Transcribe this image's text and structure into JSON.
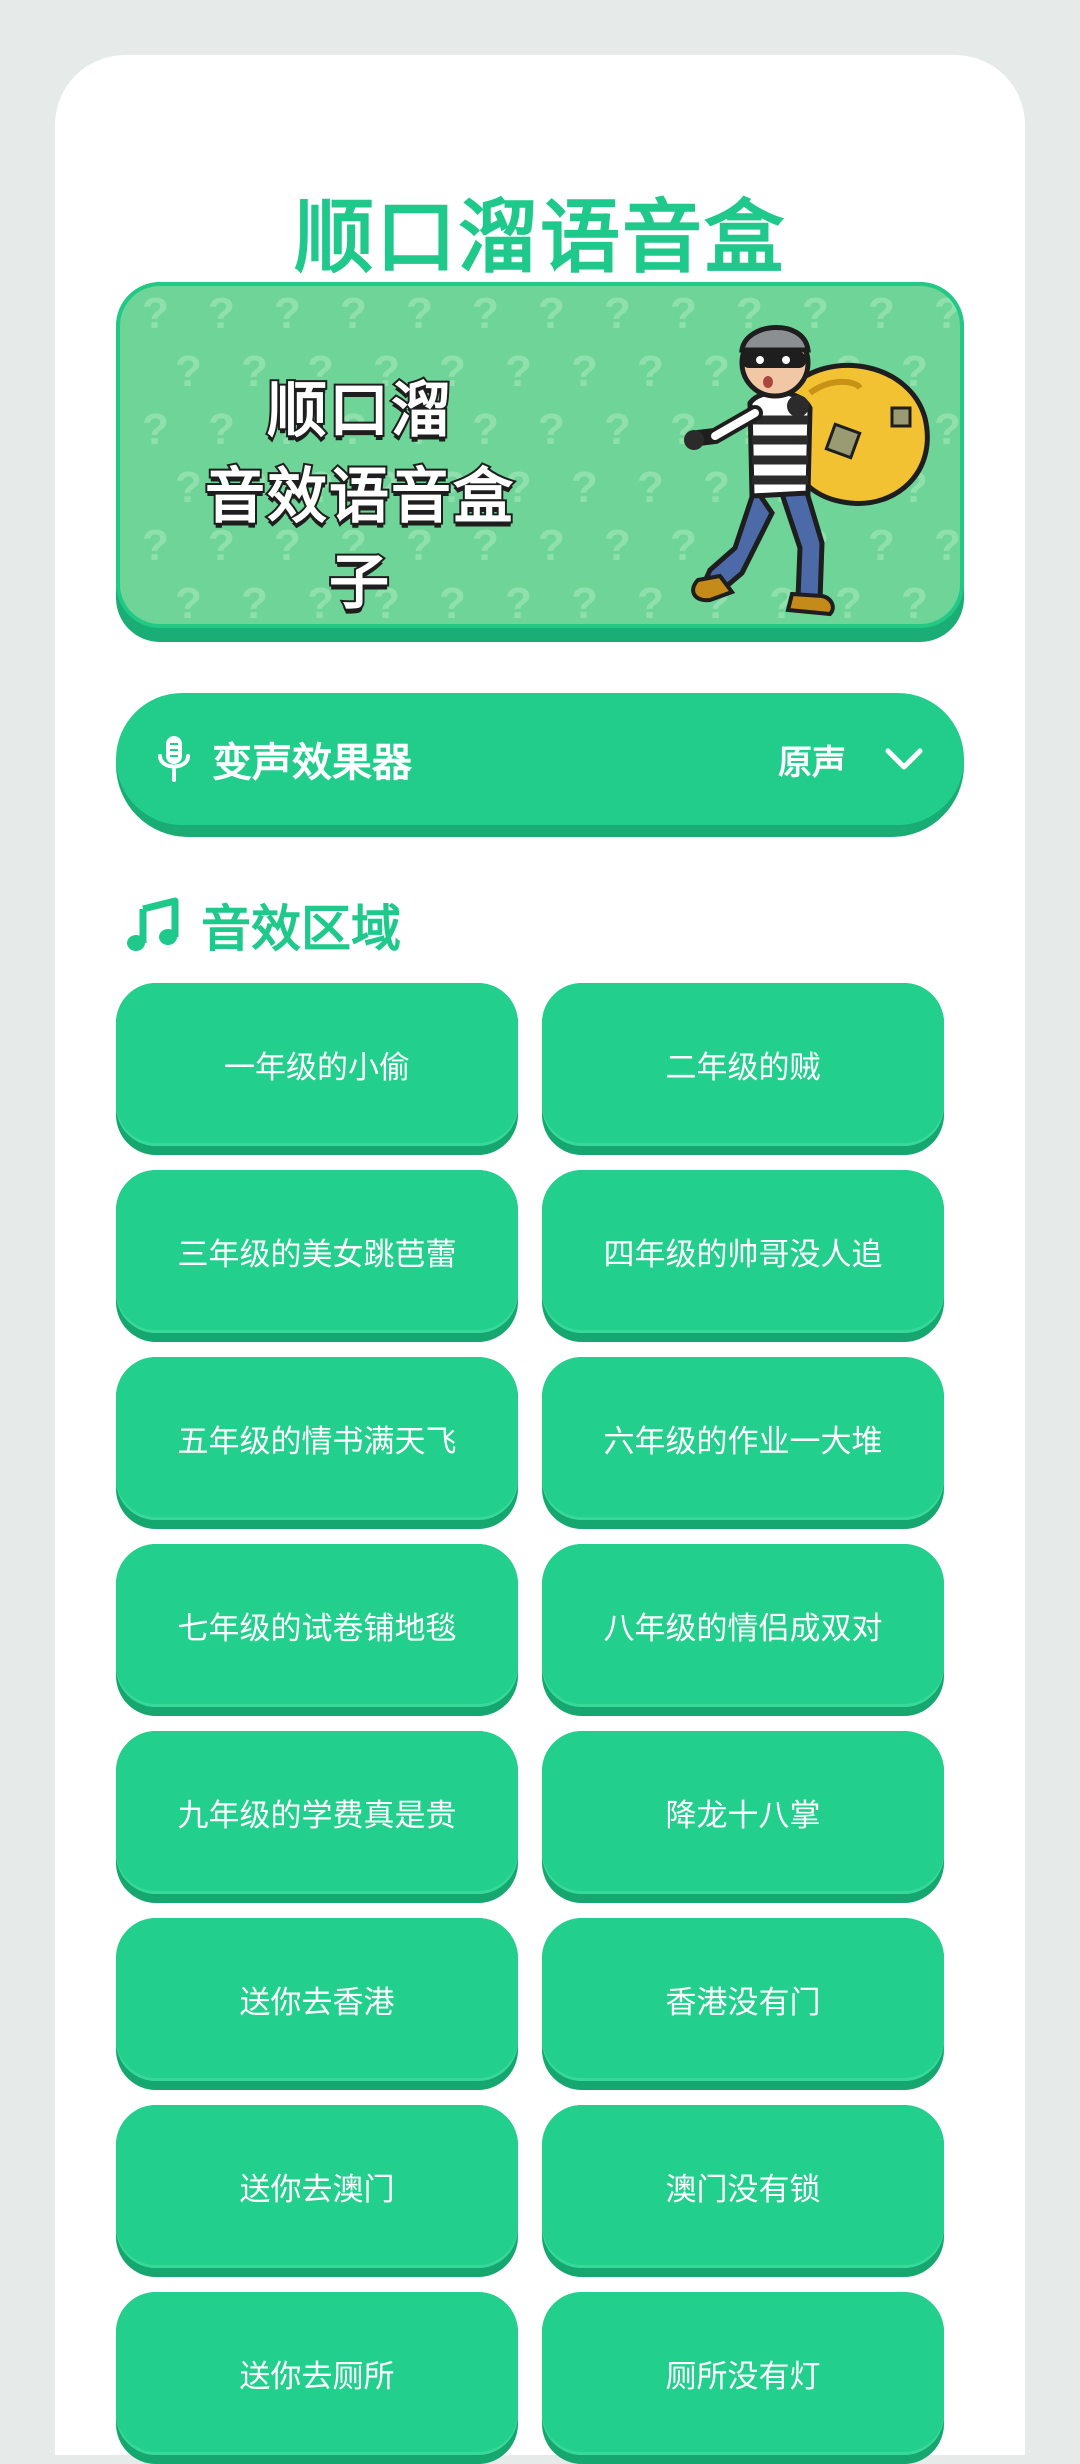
{
  "header": {
    "title": "顺口溜语音盒"
  },
  "banner": {
    "line1": "顺口溜",
    "line2": "音效语音盒子",
    "pattern_glyph": "?",
    "illustration": "cartoon-thief-with-loot-bag"
  },
  "voice_changer": {
    "icon": "microphone-icon",
    "title": "变声效果器",
    "selected_value": "原声",
    "dropdown_icon": "chevron-down-icon"
  },
  "section": {
    "icon": "music-note-icon",
    "title": "音效区域"
  },
  "sound_buttons": [
    "一年级的小偷",
    "二年级的贼",
    "三年级的美女跳芭蕾",
    "四年级的帅哥没人追",
    "五年级的情书满天飞",
    "六年级的作业一大堆",
    "七年级的试卷铺地毯",
    "八年级的情侣成双对",
    "九年级的学费真是贵",
    "降龙十八掌",
    "送你去香港",
    "香港没有门",
    "送你去澳门",
    "澳门没有锁",
    "送你去厕所",
    "厕所没有灯"
  ],
  "colors": {
    "accent": "#1fc98b",
    "button": "#22cf8d",
    "button_shadow": "#16a66f",
    "banner_bg": "#6fd497",
    "page_bg": "#e6ebea",
    "card_bg": "#ffffff"
  }
}
